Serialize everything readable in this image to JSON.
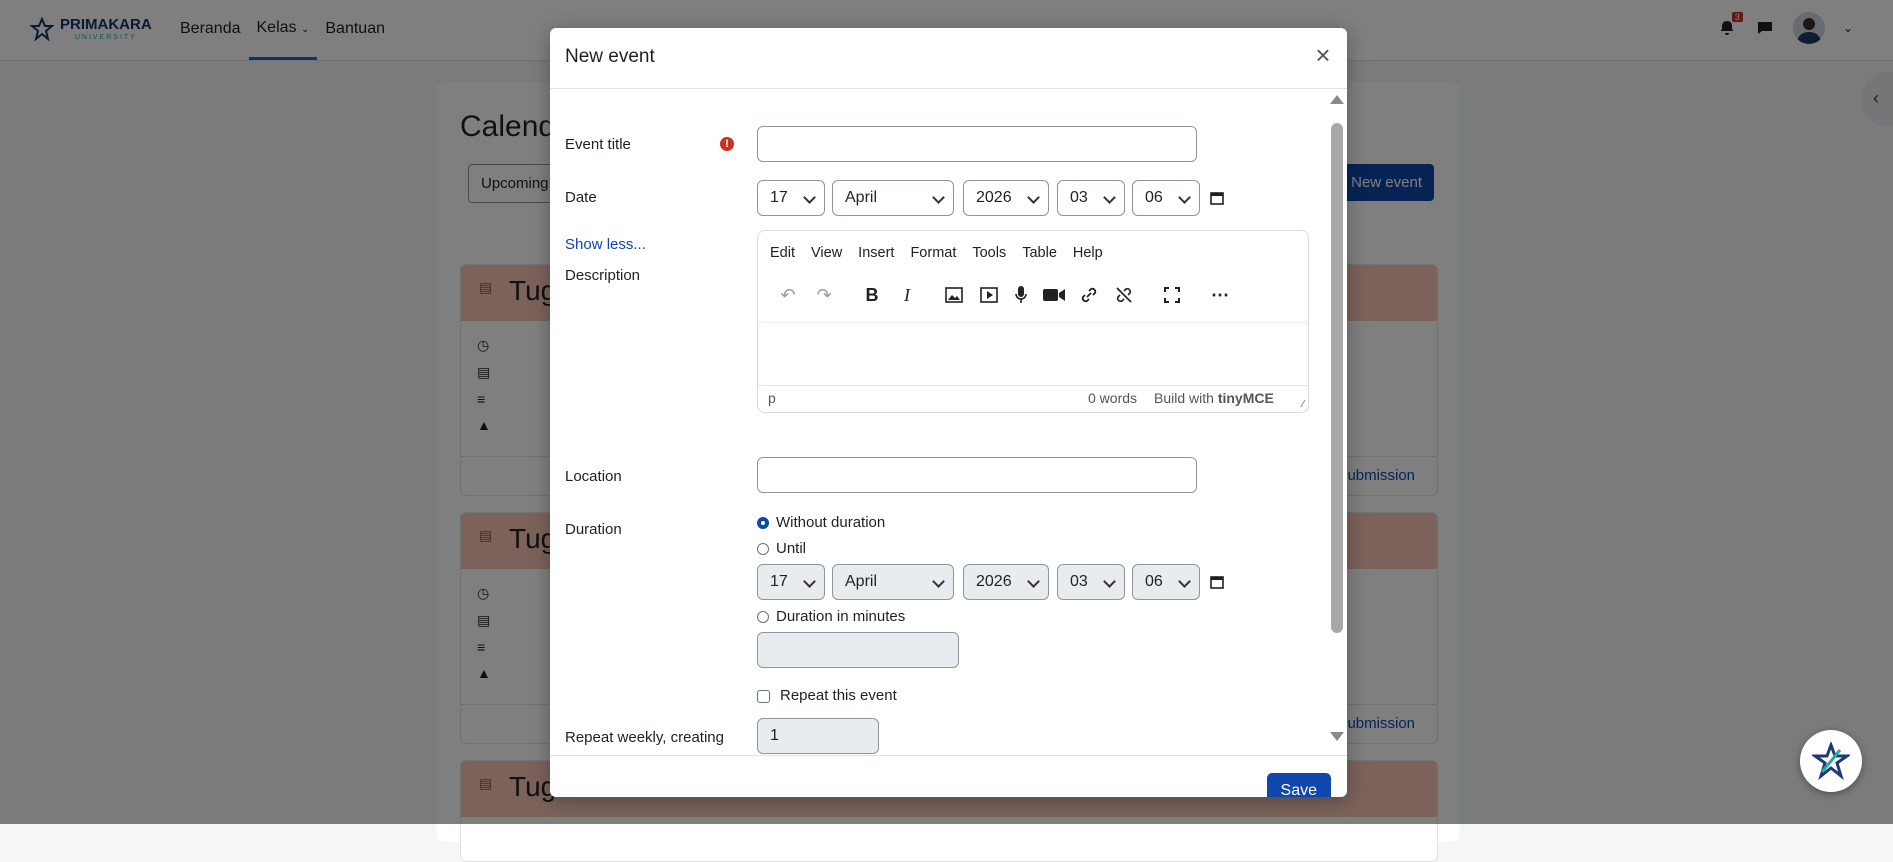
{
  "app": {
    "logo_text": "PRIMAKARA",
    "logo_sub": "UNIVERSITY"
  },
  "nav": {
    "items": [
      "Beranda",
      "Kelas",
      "Bantuan"
    ],
    "active": "Kelas"
  },
  "notifications": {
    "count": "3"
  },
  "page": {
    "heading": "Calend",
    "upcoming_label": "Upcoming",
    "new_event_label": "New event",
    "cards": [
      {
        "title": "Tug",
        "footer": "submission"
      },
      {
        "title": "Tug",
        "footer": "submission"
      },
      {
        "title": "Tug"
      }
    ]
  },
  "modal": {
    "title": "New event",
    "event_title": {
      "label": "Event title",
      "value": ""
    },
    "date": {
      "label": "Date",
      "day": "17",
      "month": "April",
      "year": "2026",
      "hour": "03",
      "minute": "06"
    },
    "show_less": "Show less...",
    "description": {
      "label": "Description",
      "menu": [
        "Edit",
        "View",
        "Insert",
        "Format",
        "Tools",
        "Table",
        "Help"
      ],
      "status_tag": "p",
      "word_count": "0 words",
      "build_with": "Build with",
      "brand": "tinyMCE"
    },
    "location": {
      "label": "Location",
      "value": ""
    },
    "duration": {
      "label": "Duration",
      "options": [
        "Without duration",
        "Until",
        "Duration in minutes"
      ],
      "selected": "Without duration",
      "until": {
        "day": "17",
        "month": "April",
        "year": "2026",
        "hour": "03",
        "minute": "06"
      },
      "minutes_value": ""
    },
    "repeat": {
      "label": "Repeat this event",
      "checked": false
    },
    "repeat_weekly": {
      "label": "Repeat weekly, creating",
      "value": "1"
    },
    "save_label": "Save"
  },
  "colors": {
    "primary": "#0f47ad",
    "danger": "#ca3120",
    "card_header": "#f7c7b7"
  }
}
